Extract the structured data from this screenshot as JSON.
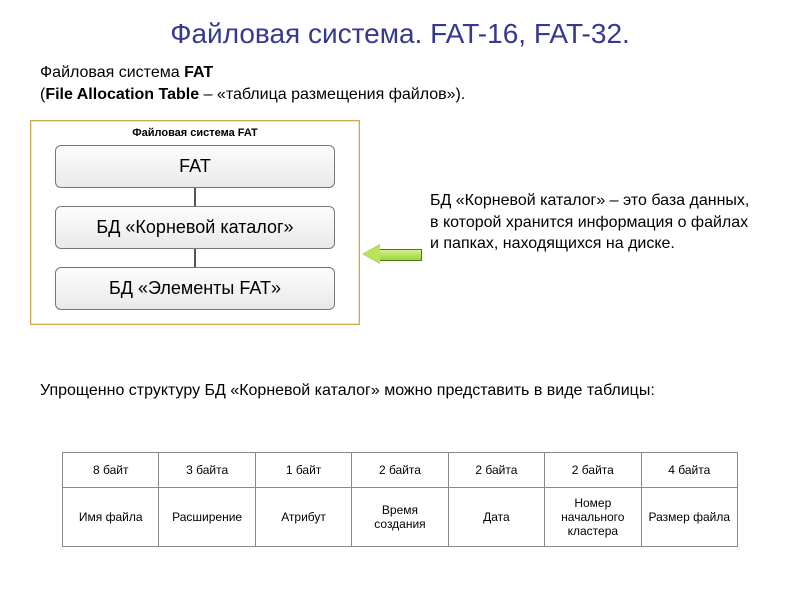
{
  "title": "Файловая система. FAT-16, FAT-32.",
  "intro": {
    "line1_prefix": "Файловая система ",
    "line1_bold": "FAT",
    "line2_open": "(",
    "line2_bold": "File Allocation Table",
    "line2_rest": " – «таблица размещения файлов»)."
  },
  "diagram": {
    "caption": "Файловая система FAT",
    "node1": "FAT",
    "node2": "БД «Корневой каталог»",
    "node3": "БД «Элементы FAT»"
  },
  "side_note": "БД «Корневой каталог» – это база данных, в которой хранится информация о файлах и папках, находящихся на диске.",
  "below_note": "Упрощенно структуру БД «Корневой каталог» можно представить в виде таблицы:",
  "table": {
    "row_sizes": [
      "8 байт",
      "3 байта",
      "1 байт",
      "2 байта",
      "2 байта",
      "2 байта",
      "4 байта"
    ],
    "row_labels": [
      "Имя файла",
      "Расширение",
      "Атрибут",
      "Время создания",
      "Дата",
      "Номер начального кластера",
      "Размер файла"
    ]
  }
}
